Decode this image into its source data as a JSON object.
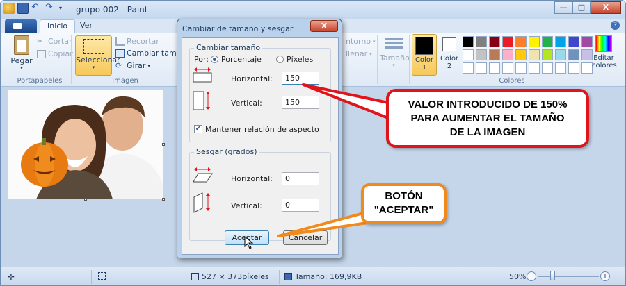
{
  "window": {
    "title": "grupo 002 - Paint",
    "buttons": {
      "minimize": "—",
      "maximize": "□",
      "close": "X"
    }
  },
  "ribbon": {
    "tabs": [
      "Inicio",
      "Ver"
    ],
    "portapapeles": {
      "paste": "Pegar",
      "cut": "Cortar",
      "copy": "Copiar",
      "group": "Portapapeles"
    },
    "imagen": {
      "select": "Seleccionar",
      "crop": "Recortar",
      "resize": "Cambiar tamaño",
      "rotate": "Girar",
      "group": "Imagen"
    },
    "herramientas": {
      "outline": "ntorno",
      "fill": "llenar",
      "size": "Tamaño"
    },
    "colores": {
      "color1": "Color 1",
      "color2": "Color 2",
      "edit": "Editar colores",
      "group": "Colores",
      "color1_value": "#000000",
      "color2_value": "#ffffff",
      "palette": [
        "#000000",
        "#7f7f7f",
        "#880015",
        "#ed1c24",
        "#ff7f27",
        "#fff200",
        "#22b14c",
        "#00a2e8",
        "#3f48cc",
        "#a349a4",
        "#ffffff",
        "#c3c3c3",
        "#b97a57",
        "#ffaec9",
        "#ffc90e",
        "#efe4b0",
        "#b5e61d",
        "#99d9ea",
        "#7092be",
        "#c8bfe7",
        "#ffffff",
        "#ffffff",
        "#ffffff",
        "#ffffff",
        "#ffffff",
        "#ffffff",
        "#ffffff",
        "#ffffff",
        "#ffffff",
        "#ffffff"
      ]
    }
  },
  "status": {
    "dimensions": "527 × 373píxeles",
    "size": "Tamaño: 169,9KB",
    "zoom": "50%",
    "zoom_level": 0.5
  },
  "dialog": {
    "title": "Cambiar de tamaño y sesgar",
    "close": "X",
    "resize": {
      "legend": "Cambiar tamaño",
      "by": "Por:",
      "percent": "Porcentaje",
      "pixels": "Píxeles",
      "horizontal_label": "Horizontal:",
      "horizontal_value": "150",
      "vertical_label": "Vertical:",
      "vertical_value": "150",
      "keep_ratio": "Mantener relación de aspecto"
    },
    "skew": {
      "legend": "Sesgar (grados)",
      "horizontal_label": "Horizontal:",
      "horizontal_value": "0",
      "vertical_label": "Vertical:",
      "vertical_value": "0"
    },
    "ok": "Aceptar",
    "cancel": "Cancelar"
  },
  "callouts": {
    "red": [
      "VALOR INTRODUCIDO DE 150%",
      "PARA AUMENTAR EL TAMAÑO",
      "DE LA IMAGEN"
    ],
    "orange": [
      "BOTÓN",
      "\"ACEPTAR\""
    ]
  },
  "colors": {
    "red_callout": "#e0141a",
    "orange_callout": "#f08a1c",
    "ribbon_bg": "#dfe9f5"
  }
}
